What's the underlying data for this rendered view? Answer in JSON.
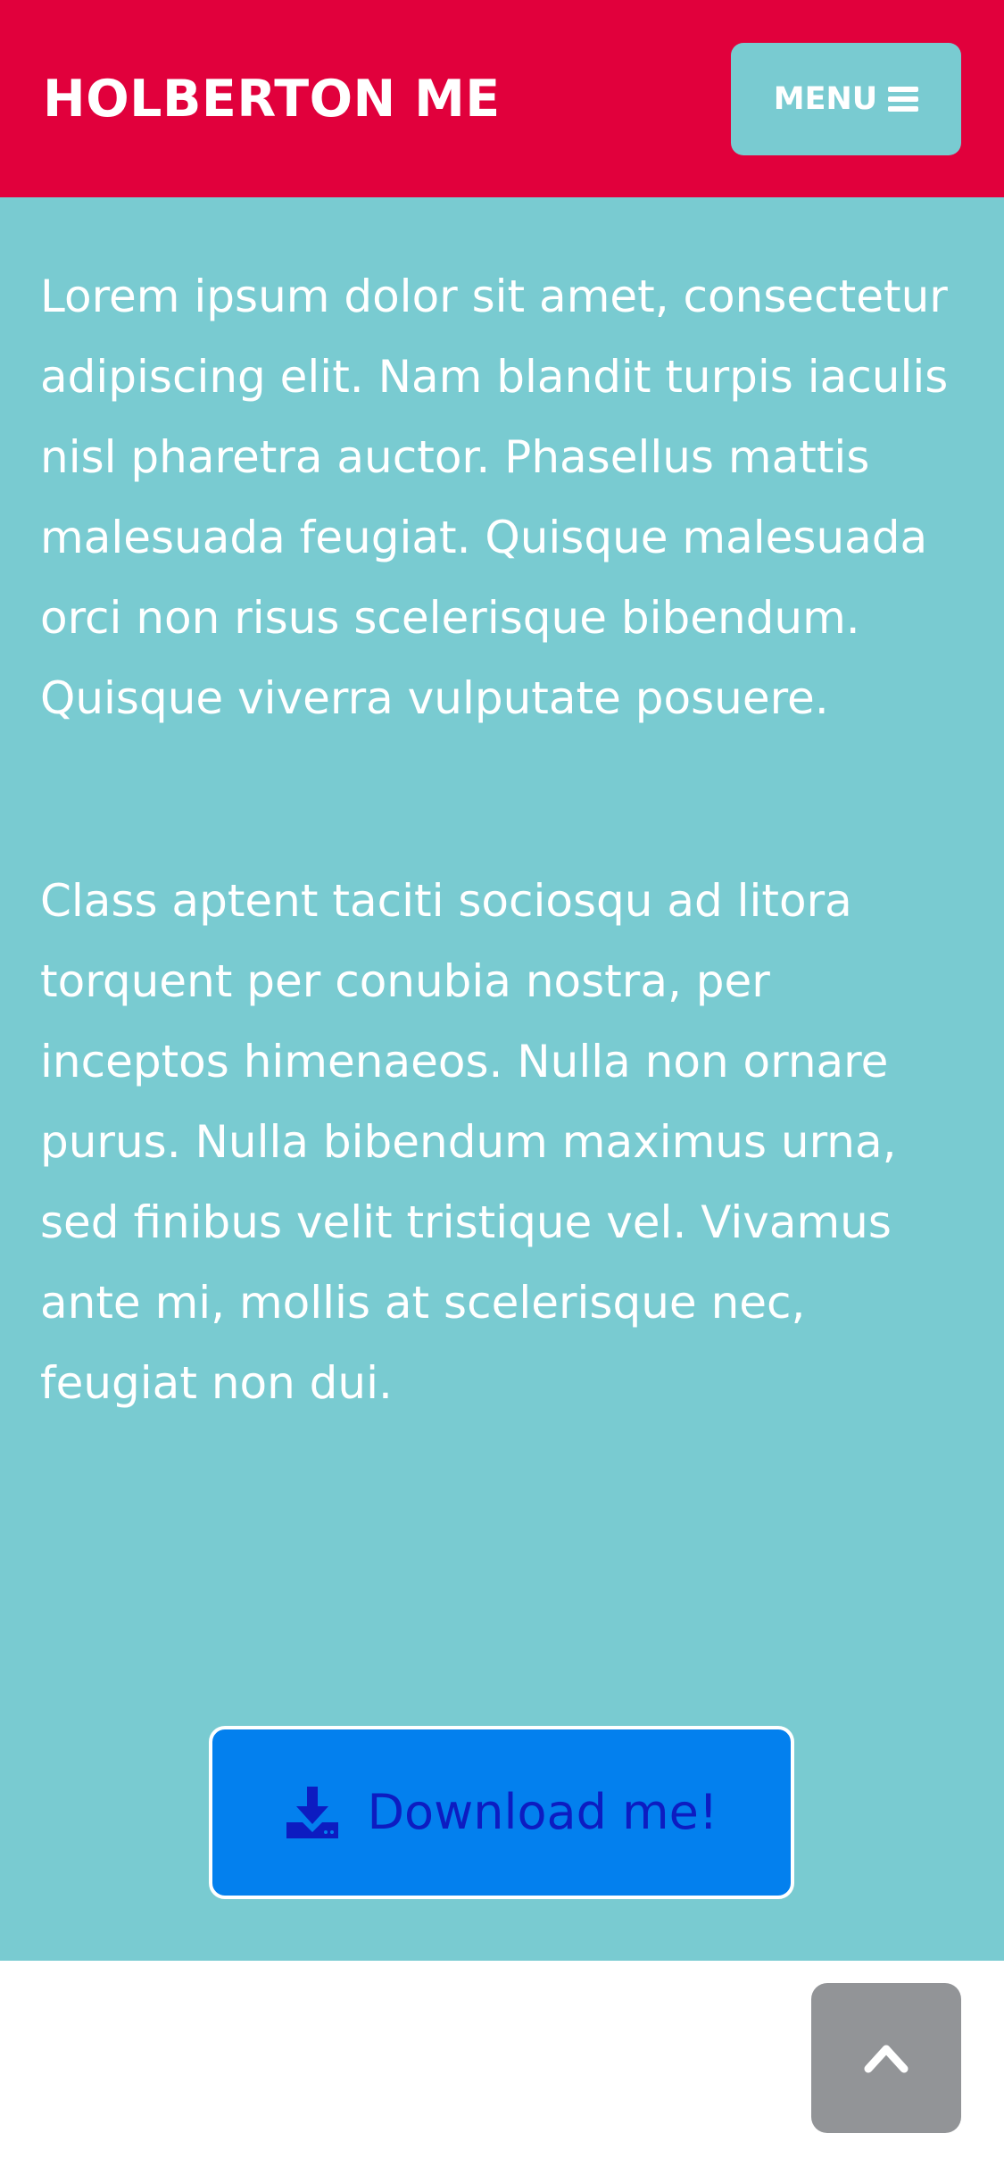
{
  "header": {
    "brand": "HOLBERTON ME",
    "menu_label": "MENU",
    "menu_icon": "hamburger-icon",
    "background_color": "#e1003c"
  },
  "main": {
    "background_color": "#79cbd1",
    "paragraphs": [
      "Lorem ipsum dolor sit amet, consectetur adipiscing elit. Nam blandit turpis iaculis nisl pharetra auctor. Phasellus mattis malesuada feugiat. Quisque malesuada orci non risus scelerisque bibendum. Quisque viverra vulputate posuere.",
      "Class aptent taciti sociosqu ad litora torquent per conubia nostra, per inceptos himenaeos. Nulla non ornare purus. Nulla bibendum maximus urna, sed finibus velit tristique vel. Vivamus ante mi, mollis at scelerisque nec, feugiat non dui."
    ],
    "download": {
      "label": "Download me!",
      "icon": "download-icon",
      "background_color": "#0380ee",
      "text_color": "#0d1cc1"
    }
  },
  "footer": {
    "back_to_top_icon": "chevron-up-icon",
    "button_color": "#929497"
  }
}
